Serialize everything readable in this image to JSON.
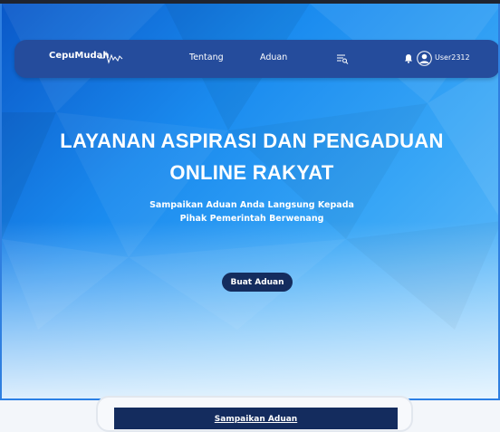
{
  "navbar": {
    "logo_text": "CepuMudah",
    "links": [
      "Tentang",
      "Aduan"
    ],
    "username": "User2312",
    "icons": [
      "list-search-icon",
      "bell-icon",
      "user-avatar-icon"
    ]
  },
  "hero": {
    "title_line1": "LAYANAN ASPIRASI DAN PENGADUAN",
    "title_line2": "ONLINE RAKYAT",
    "subtitle_line1": "Sampaikan Aduan Anda Langsung Kepada",
    "subtitle_line2": "Pihak Pemerintah Berwenang",
    "cta_label": "Buat Aduan"
  },
  "form": {
    "header": "Sampaikan Aduan"
  },
  "colors": {
    "navbar_bg": "#254c9c",
    "hero_blue": "#1a8bef",
    "button_dark": "#142c5e"
  }
}
